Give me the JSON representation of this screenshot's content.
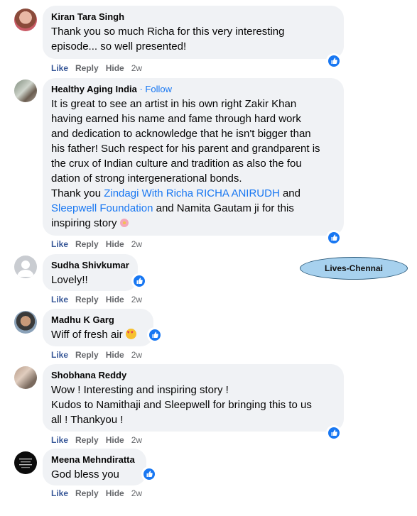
{
  "comments": [
    {
      "author": "Kiran Tara Singh",
      "text_lines": [
        "Thank you so much Richa for this very interesting",
        "episode... so well presented!"
      ],
      "actions": {
        "like": "Like",
        "reply": "Reply",
        "hide": "Hide",
        "time": "2w"
      }
    },
    {
      "author": "Healthy Aging India",
      "follow_sep": " · ",
      "follow": "Follow",
      "text_lines": [
        "It is great to see an artist in his own right Zakir Khan",
        "having earned his name and fame through hard work",
        "and dedication to acknowledge that he isn't bigger than",
        "his father! Such respect for his parent and grandparent is",
        "the crux of Indian culture and tradition as also the fou",
        "dation of strong intergenerational bonds."
      ],
      "thanks_prefix": "Thank you ",
      "mention1": "Zindagi With Richa RICHA ANIRUDH",
      "and1": " and",
      "mention2": "Sleepwell Foundation",
      "thanks_suffix": " and Namita Gautam ji for this",
      "last_line": "inspiring story",
      "actions": {
        "like": "Like",
        "reply": "Reply",
        "hide": "Hide",
        "time": "2w"
      }
    },
    {
      "author": "Sudha Shivkumar",
      "text_lines": [
        "Lovely!!"
      ],
      "actions": {
        "like": "Like",
        "reply": "Reply",
        "hide": "Hide",
        "time": "2w"
      }
    },
    {
      "author": "Madhu K Garg",
      "text_lines": [
        "Wiff of fresh air"
      ],
      "actions": {
        "like": "Like",
        "reply": "Reply",
        "hide": "Hide",
        "time": "2w"
      }
    },
    {
      "author": "Shobhana Reddy",
      "text_lines": [
        "Wow ! Interesting and inspiring story !",
        "Kudos to Namithaji and Sleepwell for bringing this to us",
        "all ! Thankyou !"
      ],
      "actions": {
        "like": "Like",
        "reply": "Reply",
        "hide": "Hide",
        "time": "2w"
      }
    },
    {
      "author": "Meena Mehndiratta",
      "text_lines": [
        "God bless you"
      ],
      "actions": {
        "like": "Like",
        "reply": "Reply",
        "hide": "Hide",
        "time": "2w"
      }
    }
  ],
  "watermark": "Lives-Chennai",
  "colors": {
    "link": "#1877f2",
    "bubble": "#f0f2f5",
    "meta": "#65676b"
  },
  "icons": {
    "reaction": "like-thumb-icon",
    "flower": "flower-emoji-icon",
    "heart_eyes": "heart-eyes-emoji-icon"
  }
}
